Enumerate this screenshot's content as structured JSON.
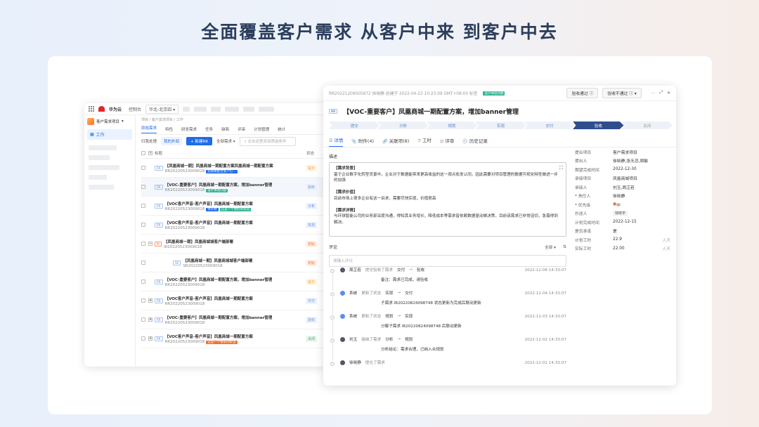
{
  "headline": "全面覆盖客户需求 从客户中来 到客户中去",
  "left": {
    "brand": "华为云",
    "console": "控制台",
    "region": "华北-北京四",
    "project": "客户需求项目",
    "nav_work": "工作",
    "breadcrumb": "项目 / 客户需求项目 / 工作",
    "tabs": [
      "原始需求",
      "特性",
      "研发需求",
      "任务",
      "缺陷",
      "评审",
      "计划管理",
      "统计"
    ],
    "subtabs": [
      "归我处理",
      "我的外部"
    ],
    "new_btn": "+ 新建RR",
    "filter": "全部需求",
    "search_placeholder": "点击这里添加筛选条件",
    "col_title": "标题",
    "col_status": "状态",
    "rows": [
      {
        "title": "【凤凰商城一期】凤凰商城一期配置方案凤凰商城一期配置方案",
        "id": "RR20220523009018",
        "tag": "您需要配合客户打...",
        "tagColor": "#1e6ce8",
        "status": "提交",
        "sc": "#f0a030",
        "bg": "#fff6ea"
      },
      {
        "title": "【VOC-重要客户】凤凰商城一期配置方案，增加banner管理",
        "id": "RR20220523009018",
        "tag": "设计体验问题",
        "tagColor": "#2db392",
        "status": "验收",
        "sc": "#6b8fd6",
        "bg": "#eef3fc",
        "hl": true
      },
      {
        "title": "【VOC客户声音-客户声音】凤凰商城一期配置方案",
        "id": "RR20220523009018",
        "tag": "待开始",
        "tag2": "这是一个更好的标签",
        "tagColor": "#1e6ce8",
        "tag2Color": "#2db392",
        "status": "分析",
        "sc": "#5b8def",
        "bg": "#eef3fc"
      },
      {
        "title": "【VOC客户声音-客户声音】凤凰商城一期配置方案",
        "id": "RR20220523009018",
        "status": "实现",
        "sc": "#5b8def",
        "bg": "#eef3fc"
      },
      {
        "title": "【凤凰商城一期】凤凰商城城客户端部署",
        "id": "IR20220523009018",
        "status": "初始",
        "sc": "#f07030",
        "bg": "#fff0e8"
      },
      {
        "title": "【凤凰商城一期】凤凰商城城客户端部署",
        "id": "SR20220523009018",
        "status": "初始",
        "sc": "#f07030",
        "bg": "#fff0e8"
      },
      {
        "title": "【VOC-重要客户】凤凰商城一期配置方案，增加banner管理",
        "id": "RR20220523009018",
        "status": "提交",
        "sc": "#f0a030",
        "bg": "#fff6ea"
      },
      {
        "title": "【VOC客户声音-客户声音】凤凰商城一期配置方案",
        "id": "RR20220523009018",
        "status": "交付",
        "sc": "#5b8def",
        "bg": "#eef3fc"
      },
      {
        "title": "【VOC-重要客户】凤凰商城一期配置方案，增加banner管理",
        "id": "RR20220523009018",
        "status": "验收",
        "sc": "#6b8fd6",
        "bg": "#eef3fc"
      },
      {
        "title": "【VOC客户声音-客户声音】凤凰商城一期配置方案",
        "id": "RR20220523009018",
        "tag": "这是一个很长的标签",
        "tagColor": "#f07030",
        "status": "关闭",
        "sc": "#3aa86b",
        "bg": "#eaf7ef"
      }
    ]
  },
  "right": {
    "meta": "RR20221209005872 徐晓静 创建于 2022-04-23 10:23:09 GMT+08:00 标签",
    "meta_tag": "设计体验问题",
    "btn_pass": "验收通过",
    "btn_fail": "验收不通过",
    "title": "【VOC-重要客户】凤凰商城一期配置方案，增加banner管理",
    "steps": [
      "提交",
      "分析",
      "规划",
      "实现",
      "交付",
      "验收",
      "关闭"
    ],
    "active_step": 5,
    "tabs": [
      "详情",
      "附件(4)",
      "关联项(8)",
      "工时",
      "评审",
      "历史记录"
    ],
    "desc_label": "描述",
    "desc": [
      "【需求背景】",
      "基于企业数字化转型背景中，企业对于数据能带来更高收益的这一观点愈发认同，因此需要对项目管理的数据可视化特性做进一步的加强",
      "",
      "【需求价值】",
      "目前市场上很多企业有这一诉求，需要尽快实现，价值很高",
      "",
      "【需求详情】",
      "与环球智能公司的业务部深度沟通，得知其业务增长，降低成本等需求皆依赖数据驱动做决策，目前该需求已非常迫切，急需得到解决。"
    ],
    "comment_label": "评论",
    "comment_filter": "全部",
    "comment_placeholder": "请输入评论",
    "timeline": [
      {
        "name": "周芷若",
        "action": "提交验收了需求",
        "from": "交付",
        "to": "验收",
        "date": "2022-12-06 14:33:07",
        "sub": "备注：需求已完成，请验收",
        "sys": false
      },
      {
        "name": "系统",
        "action": "更新了状态",
        "from": "实现",
        "to": "交付",
        "date": "2022-12-04 14:33:07",
        "sub": "子需求 IR20220824098748 状态更新为完成后联动更新",
        "sys": true
      },
      {
        "name": "系统",
        "action": "更新了状态",
        "from": "规划",
        "to": "实现",
        "date": "2022-12-03 14:33:07",
        "sub": "分解子需求 IR20220824098748 后联动更新",
        "sys": true
      },
      {
        "name": "刘玉",
        "action": "接纳了需求",
        "from": "分析",
        "to": "规划",
        "date": "2022-12-02 14:33:07",
        "sub": "分析结论：需求合理，已纳入合规划",
        "sys": false
      },
      {
        "name": "徐晓静",
        "action": "提交了需求",
        "from": "",
        "to": "",
        "date": "2022-12-01 14:33:07",
        "sub": "",
        "sys": false
      }
    ],
    "props": [
      {
        "k": "提出项目",
        "v": "客户需求项目"
      },
      {
        "k": "提出人",
        "v": "徐晓静,张无忌,周敏"
      },
      {
        "k": "期望完成时间",
        "v": "2022-12-30"
      },
      {
        "k": "承接项目",
        "v": "凤凰商城项目"
      },
      {
        "k": "承接人",
        "v": "刘玉,周芷若"
      },
      {
        "k": "* 责任人",
        "v": "徐晓静"
      },
      {
        "k": "* 优先级",
        "v": "中"
      },
      {
        "k": "抄送人",
        "v": "徐晓宇",
        "pill": true
      },
      {
        "k": "计划完成时间",
        "v": "2022-12-15"
      },
      {
        "k": "是否承诺",
        "v": "是"
      },
      {
        "k": "计划工时",
        "v": "22.9",
        "unit": "人天"
      },
      {
        "k": "实际工时",
        "v": "22.00",
        "unit": "人天"
      }
    ]
  }
}
